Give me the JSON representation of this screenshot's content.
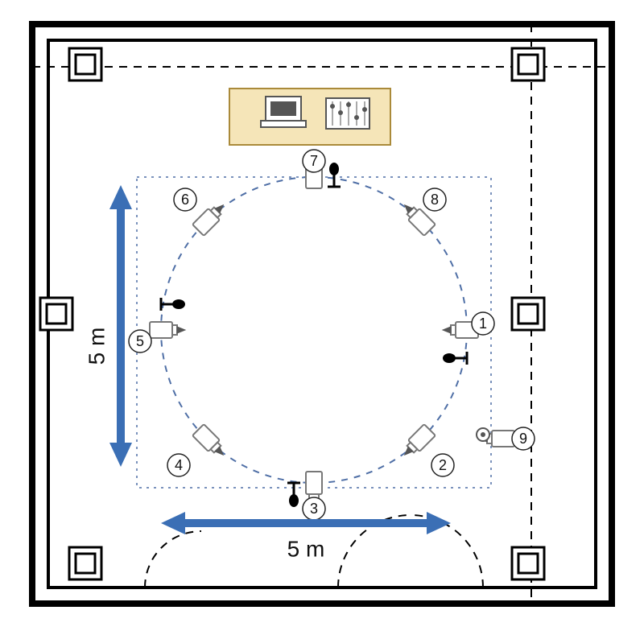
{
  "diagram": {
    "title": "Room setup floor plan with cameras and microphones",
    "room_size_label_h": "5 m",
    "room_size_label_v": "5 m",
    "positions": {
      "p1": "1",
      "p2": "2",
      "p3": "3",
      "p4": "4",
      "p5": "5",
      "p6": "6",
      "p7": "7",
      "p8": "8",
      "p9": "9"
    },
    "devices": {
      "desk": "control-desk",
      "laptop": "laptop",
      "mixer": "audio-mixer",
      "camera": "camera",
      "microphone": "microphone"
    }
  },
  "chart_data": {
    "type": "diagram",
    "description": "Square room floor plan (approx. 5 m × 5 m capture area) with a dashed circular ring of 8 camera positions (labeled 1–8) at 45° spacing, 4 microphone stands at the cardinal points of the circle, an additional camera (9) outside the circle to the lower-right, and a control desk with a laptop and audio mixer above position 7.",
    "capture_area_m": {
      "width": 5,
      "height": 5
    },
    "camera_positions_deg_from_top": [
      0,
      45,
      90,
      135,
      180,
      225,
      270,
      315
    ],
    "camera_labels_clockwise_from_top": [
      7,
      8,
      1,
      2,
      3,
      4,
      5,
      6
    ],
    "extra_camera": {
      "label": 9,
      "approx_location": "outside circle, lower-right, facing inward"
    },
    "microphone_positions_deg_from_top": [
      0,
      90,
      180,
      270
    ],
    "control_desk": {
      "location": "top-center above camera 7",
      "equipment": [
        "laptop",
        "audio-mixer"
      ]
    }
  }
}
